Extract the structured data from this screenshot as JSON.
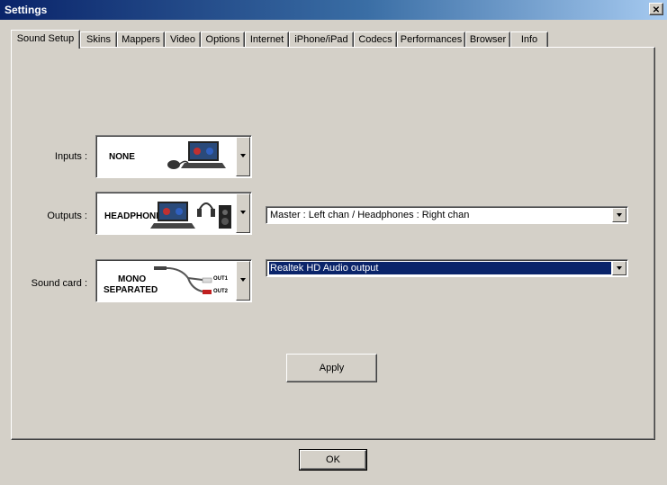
{
  "window": {
    "title": "Settings",
    "close_symbol": "✕"
  },
  "tabs": [
    {
      "label": "Sound Setup",
      "active": true
    },
    {
      "label": "Skins"
    },
    {
      "label": "Mappers"
    },
    {
      "label": "Video"
    },
    {
      "label": "Options"
    },
    {
      "label": "Internet"
    },
    {
      "label": "iPhone/iPad"
    },
    {
      "label": "Codecs"
    },
    {
      "label": "Performances"
    },
    {
      "label": "Browser"
    },
    {
      "label": "Info"
    }
  ],
  "sound_setup": {
    "inputs": {
      "label": "Inputs :",
      "image_caption": "NONE",
      "icon": "laptop-mouse-icon"
    },
    "outputs": {
      "label": "Outputs :",
      "image_caption": "HEADPHONES",
      "icon": "laptop-headphones-speaker-icon",
      "mode_value": "Master : Left chan / Headphones : Right chan"
    },
    "sound_card": {
      "label": "Sound card :",
      "image_caption_line1": "MONO",
      "image_caption_line2": "SEPARATED",
      "out1": "OUT1",
      "out2": "OUT2",
      "icon": "rca-y-cable-icon",
      "device_value": "Realtek HD Audio output"
    },
    "apply_label": "Apply"
  },
  "footer": {
    "ok_label": "OK"
  },
  "colors": {
    "face": "#d4d0c8",
    "title_start": "#0a246a",
    "title_end": "#a6caf0",
    "selection": "#0a246a"
  }
}
